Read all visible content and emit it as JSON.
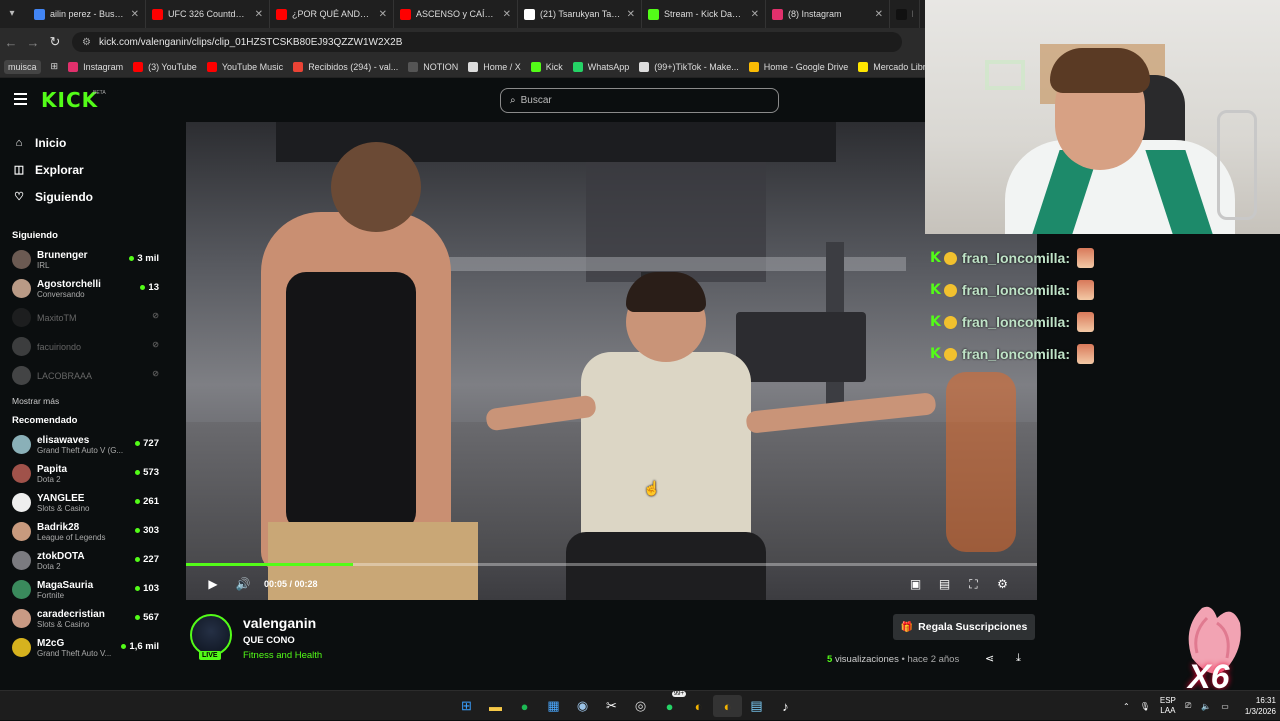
{
  "browser": {
    "tabs": [
      {
        "title": "ailin perez - Buscar co",
        "color": "#4285f4"
      },
      {
        "title": "UFC 326 Countdown",
        "color": "#ff0000"
      },
      {
        "title": "¿POR QUÉ ANDERSO",
        "color": "#ff0000"
      },
      {
        "title": "ASCENSO y CAÍDA de",
        "color": "#ff0000"
      },
      {
        "title": "(21) Tsarukyan Tackle",
        "color": "#ffffff"
      },
      {
        "title": "Stream - Kick Dashbo",
        "color": "#53fc18"
      },
      {
        "title": "(8) Instagram",
        "color": "#e1306c"
      },
      {
        "title": "Encu",
        "color": "#111111"
      }
    ],
    "url": "kick.com/valenganin/clips/clip_01HZSTCSKB80EJ93QZZW1W2X2B",
    "bookmarks": [
      {
        "label": "muisca",
        "color": ""
      },
      {
        "label": "Instagram",
        "color": "#e1306c"
      },
      {
        "label": "(3) YouTube",
        "color": "#ff0000"
      },
      {
        "label": "YouTube Music",
        "color": "#ff0000"
      },
      {
        "label": "Recibidos (294) - val...",
        "color": "#ea4335"
      },
      {
        "label": "NOTION",
        "color": "#555555"
      },
      {
        "label": "Home / X",
        "color": "#dddddd"
      },
      {
        "label": "Kick",
        "color": "#53fc18"
      },
      {
        "label": "WhatsApp",
        "color": "#25d366"
      },
      {
        "label": "(99+)TikTok - Make...",
        "color": "#dddddd"
      },
      {
        "label": "Home - Google Drive",
        "color": "#fbbc04"
      },
      {
        "label": "Mercado Libre Arge...",
        "color": "#ffe600"
      }
    ]
  },
  "kick": {
    "logo": "KICK",
    "beta": "BETA",
    "search_placeholder": "Buscar",
    "nav": {
      "home": "Inicio",
      "explore": "Explorar",
      "following": "Siguiendo"
    },
    "following_title": "Siguiendo",
    "following": [
      {
        "name": "Brunenger",
        "game": "IRL",
        "viewers": "3 mil",
        "live": true,
        "color": "#6b5a52"
      },
      {
        "name": "Agostorchelli",
        "game": "Conversando",
        "viewers": "13",
        "live": true,
        "color": "#b99a86"
      },
      {
        "name": "MaxitoTM",
        "game": "",
        "viewers": "",
        "live": false,
        "color": "#333333"
      },
      {
        "name": "facuiriondo",
        "game": "",
        "viewers": "",
        "live": false,
        "color": "#777777"
      },
      {
        "name": "LACOBRAAA",
        "game": "",
        "viewers": "",
        "live": false,
        "color": "#888888"
      }
    ],
    "show_more": "Mostrar más",
    "recommended_title": "Recomendado",
    "recommended": [
      {
        "name": "elisawaves",
        "game": "Grand Theft Auto V (G...",
        "viewers": "727",
        "color": "#8ab0b8"
      },
      {
        "name": "Papita",
        "game": "Dota 2",
        "viewers": "573",
        "color": "#a0524a"
      },
      {
        "name": "YANGLEE",
        "game": "Slots & Casino",
        "viewers": "261",
        "color": "#eeeeee"
      },
      {
        "name": "Badrik28",
        "game": "League of Legends",
        "viewers": "303",
        "color": "#c89a7e"
      },
      {
        "name": "ztokDOTA",
        "game": "Dota 2",
        "viewers": "227",
        "color": "#7b7b80"
      },
      {
        "name": "MagaSauria",
        "game": "Fortnite",
        "viewers": "103",
        "color": "#3a8a5c"
      },
      {
        "name": "caradecristian",
        "game": "Slots & Casino",
        "viewers": "567",
        "color": "#c99a84"
      },
      {
        "name": "M2cG",
        "game": "Grand Theft Auto V...",
        "viewers": "1,6 mil",
        "color": "#d6b21e"
      }
    ],
    "player": {
      "current_time": "00:05",
      "duration": "00:28",
      "progress": 0.196
    },
    "clip": {
      "channel": "valenganin",
      "title": "QUE CONO",
      "category": "Fitness and Health",
      "live_label": "LIVE",
      "gift_label": "Regala Suscripciones",
      "views_count": "5",
      "views_label": "visualizaciones",
      "ago": "• hace 2 años"
    }
  },
  "overlay": {
    "chat": [
      {
        "user": "fran_loncomilla:"
      },
      {
        "user": "fran_loncomilla:"
      },
      {
        "user": "fran_loncomilla:"
      },
      {
        "user": "fran_loncomilla:"
      }
    ],
    "gift_multiplier": "X6"
  },
  "taskbar": {
    "language": "ESP",
    "layout": "LAA",
    "time": "16:31",
    "date": "1/3/2026",
    "whatsapp_badge": "99+"
  }
}
